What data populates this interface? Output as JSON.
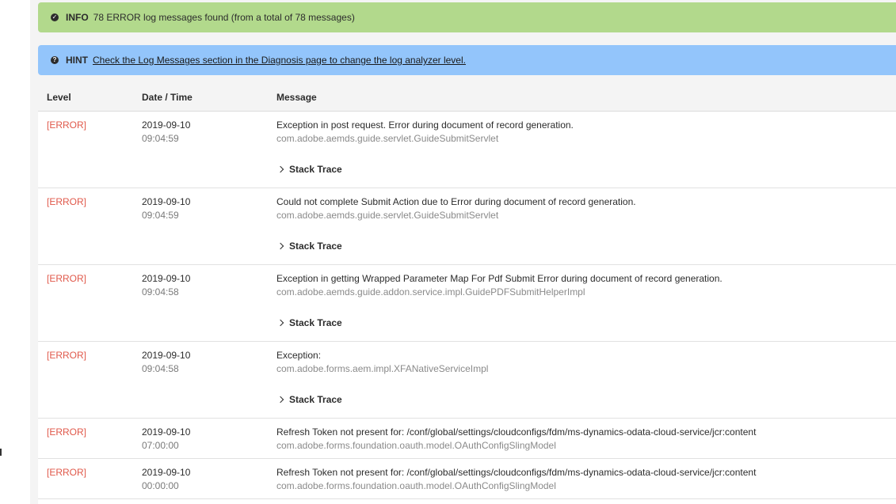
{
  "info": {
    "label": "INFO",
    "text": "78 ERROR log messages found (from a total of 78 messages)"
  },
  "hint": {
    "label": "HINT",
    "link_text": "Check the Log Messages section in the Diagnosis page to change the log analyzer level."
  },
  "table": {
    "headers": {
      "level": "Level",
      "datetime": "Date / Time",
      "message": "Message"
    },
    "rows": [
      {
        "level": "[ERROR]",
        "date": "2019-09-10",
        "time": "09:04:59",
        "message": "Exception in post request. Error during document of record generation.",
        "logger": "com.adobe.aemds.guide.servlet.GuideSubmitServlet",
        "trace": "Stack Trace"
      },
      {
        "level": "[ERROR]",
        "date": "2019-09-10",
        "time": "09:04:59",
        "message": "Could not complete Submit Action due to Error during document of record generation.",
        "logger": "com.adobe.aemds.guide.servlet.GuideSubmitServlet",
        "trace": "Stack Trace"
      },
      {
        "level": "[ERROR]",
        "date": "2019-09-10",
        "time": "09:04:58",
        "message": "Exception in getting Wrapped Parameter Map For Pdf Submit Error during document of record generation.",
        "logger": "com.adobe.aemds.guide.addon.service.impl.GuidePDFSubmitHelperImpl",
        "trace": "Stack Trace"
      },
      {
        "level": "[ERROR]",
        "date": "2019-09-10",
        "time": "09:04:58",
        "message": "Exception:",
        "logger": "com.adobe.forms.aem.impl.XFANativeServiceImpl",
        "trace": "Stack Trace"
      },
      {
        "level": "[ERROR]",
        "date": "2019-09-10",
        "time": "07:00:00",
        "message": "Refresh Token not present for: /conf/global/settings/cloudconfigs/fdm/ms-dynamics-odata-cloud-service/jcr:content",
        "logger": "com.adobe.forms.foundation.oauth.model.OAuthConfigSlingModel"
      },
      {
        "level": "[ERROR]",
        "date": "2019-09-10",
        "time": "00:00:00",
        "message": "Refresh Token not present for: /conf/global/settings/cloudconfigs/fdm/ms-dynamics-odata-cloud-service/jcr:content",
        "logger": "com.adobe.forms.foundation.oauth.model.OAuthConfigSlingModel"
      }
    ]
  }
}
